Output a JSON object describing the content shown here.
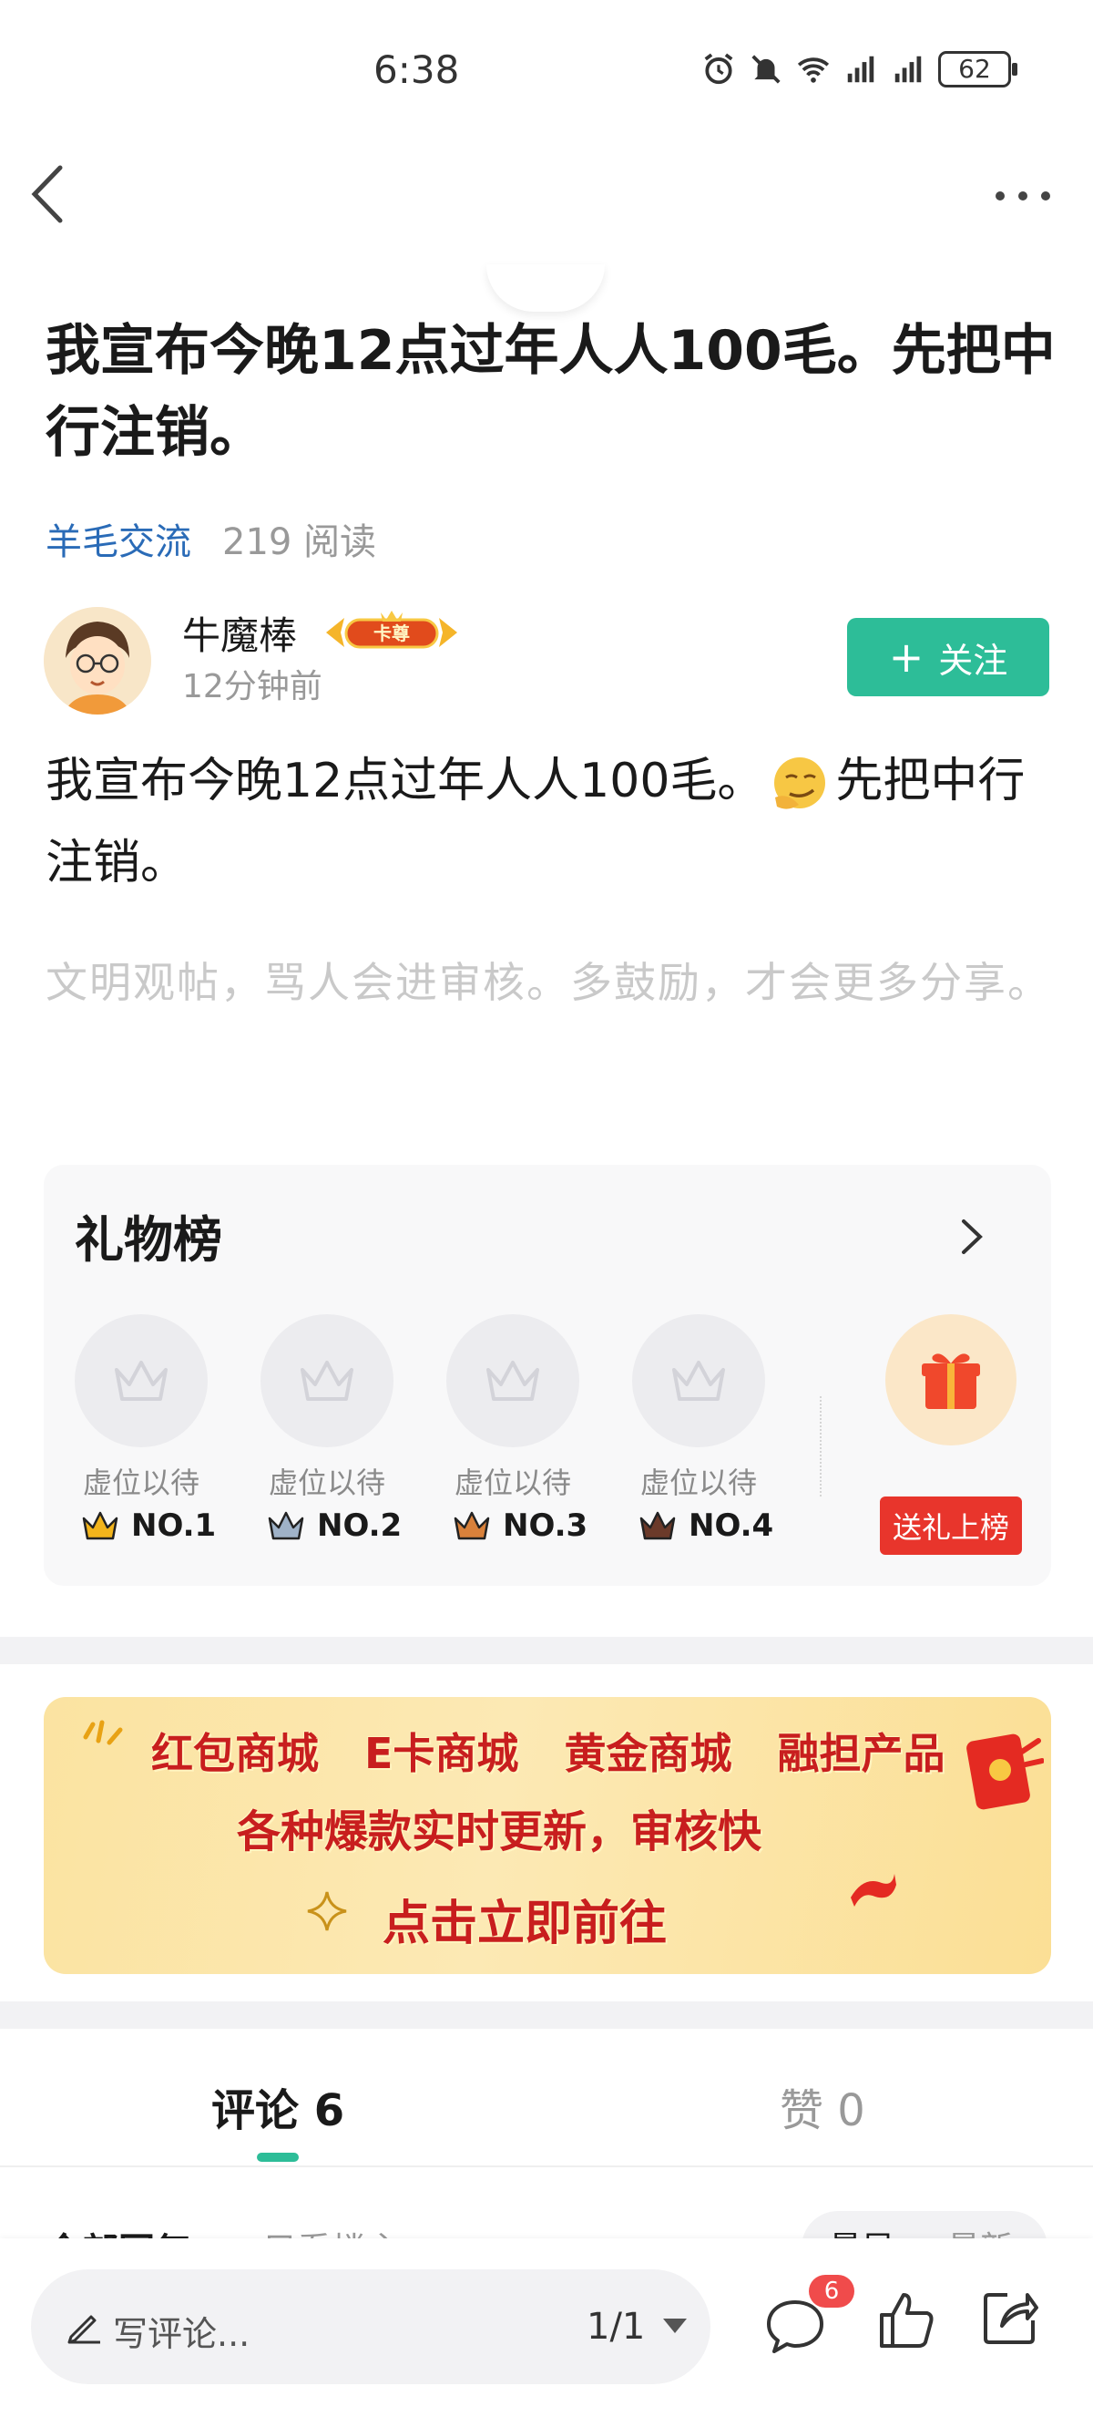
{
  "status_bar": {
    "time": "6:38",
    "battery": "62"
  },
  "post": {
    "title": "我宣布今晚12点过年人人100毛。先把中行注销。",
    "tag": "羊毛交流",
    "reads": "219 阅读",
    "body_part1": "我宣布今晚12点过年人人100毛。",
    "body_part2": "先把中行注销。",
    "civility_notice": "文明观帖，骂人会进审核。多鼓励，才会更多分享。"
  },
  "author": {
    "name": "牛魔棒",
    "badge_text": "卡尊",
    "time": "12分钟前",
    "follow_label": "关注"
  },
  "gift_board": {
    "title": "礼物榜",
    "slots": [
      {
        "label": "虚位以待",
        "rank": "NO.1",
        "crown_color": "#f2b41c"
      },
      {
        "label": "虚位以待",
        "rank": "NO.2",
        "crown_color": "#9fb2c8"
      },
      {
        "label": "虚位以待",
        "rank": "NO.3",
        "crown_color": "#d9813b"
      },
      {
        "label": "虚位以待",
        "rank": "NO.4",
        "crown_color": "#6b3a2a"
      }
    ],
    "send_button": "送礼上榜"
  },
  "banner": {
    "line1": [
      "红包商城",
      "E卡商城",
      "黄金商城",
      "融担产品"
    ],
    "line2": "各种爆款实时更新，审核快",
    "line3": "点击立即前往"
  },
  "tabs": {
    "comments": "评论 6",
    "likes": "赞 0"
  },
  "filter": {
    "all": "全部回复",
    "op_only": "只看楼主",
    "sort_hot": "最早",
    "sort_new": "最新"
  },
  "bottom_bar": {
    "placeholder": "写评论...",
    "page": "1/1",
    "comment_count": "6"
  },
  "colors": {
    "accent": "#2dbd98",
    "link": "#2a6bb7",
    "red": "#e8352c"
  }
}
